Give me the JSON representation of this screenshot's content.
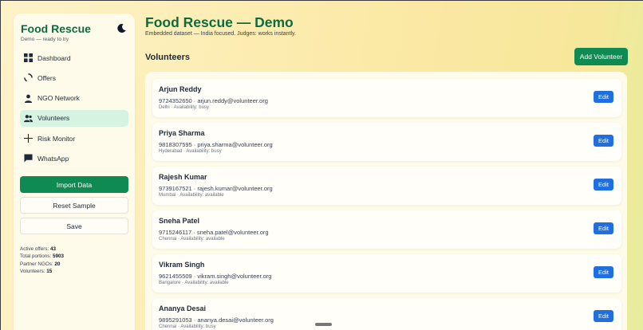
{
  "sidebar": {
    "brand": "Food Rescue",
    "subtitle": "Demo — ready to try",
    "theme_toggle_icon": "moon-icon",
    "items": [
      {
        "label": "Dashboard",
        "icon": "grid-icon",
        "active": false
      },
      {
        "label": "Offers",
        "icon": "spinner-icon",
        "active": false
      },
      {
        "label": "NGO Network",
        "icon": "person-icon",
        "active": false
      },
      {
        "label": "Volunteers",
        "icon": "people-icon",
        "active": true
      },
      {
        "label": "Risk Monitor",
        "icon": "crosshair-icon",
        "active": false
      },
      {
        "label": "WhatsApp",
        "icon": "chat-icon",
        "active": false
      }
    ],
    "import_label": "Import Data",
    "reset_label": "Reset Sample",
    "save_label": "Save",
    "stats": [
      {
        "label": "Active offers:",
        "value": "43"
      },
      {
        "label": "Total portions:",
        "value": "5903"
      },
      {
        "label": "Partner NGOs:",
        "value": "20"
      },
      {
        "label": "Volunteers:",
        "value": "15"
      }
    ]
  },
  "main": {
    "title": "Food Rescue — Demo",
    "subtitle": "Embedded dataset — India focused. Judges: works instantly.",
    "section_title": "Volunteers",
    "add_label": "Add Volunteer",
    "edit_label": "Edit",
    "volunteers": [
      {
        "name": "Arjun Reddy",
        "contact": "9724352650 · arjun.reddy@volunteer.org",
        "meta": "Delhi · Availability: busy"
      },
      {
        "name": "Priya Sharma",
        "contact": "9818307595 · priya.sharma@volunteer.org",
        "meta": "Hyderabad · Availability: busy"
      },
      {
        "name": "Rajesh Kumar",
        "contact": "9739167521 · rajesh.kumar@volunteer.org",
        "meta": "Mumbai · Availability: available"
      },
      {
        "name": "Sneha Patel",
        "contact": "9715246117 · sneha.patel@volunteer.org",
        "meta": "Chennai · Availability: available"
      },
      {
        "name": "Vikram Singh",
        "contact": "9621455509 · vikram.singh@volunteer.org",
        "meta": "Bangalore · Availability: available"
      },
      {
        "name": "Ananya Desai",
        "contact": "9895291053 · ananya.desai@volunteer.org",
        "meta": "Chennai · Availability: busy"
      }
    ]
  },
  "colors": {
    "brand_green": "#0f6b3e",
    "button_green": "#0e8a52",
    "active_nav": "#d6f3e2",
    "edit_blue": "#1f6fe0"
  }
}
